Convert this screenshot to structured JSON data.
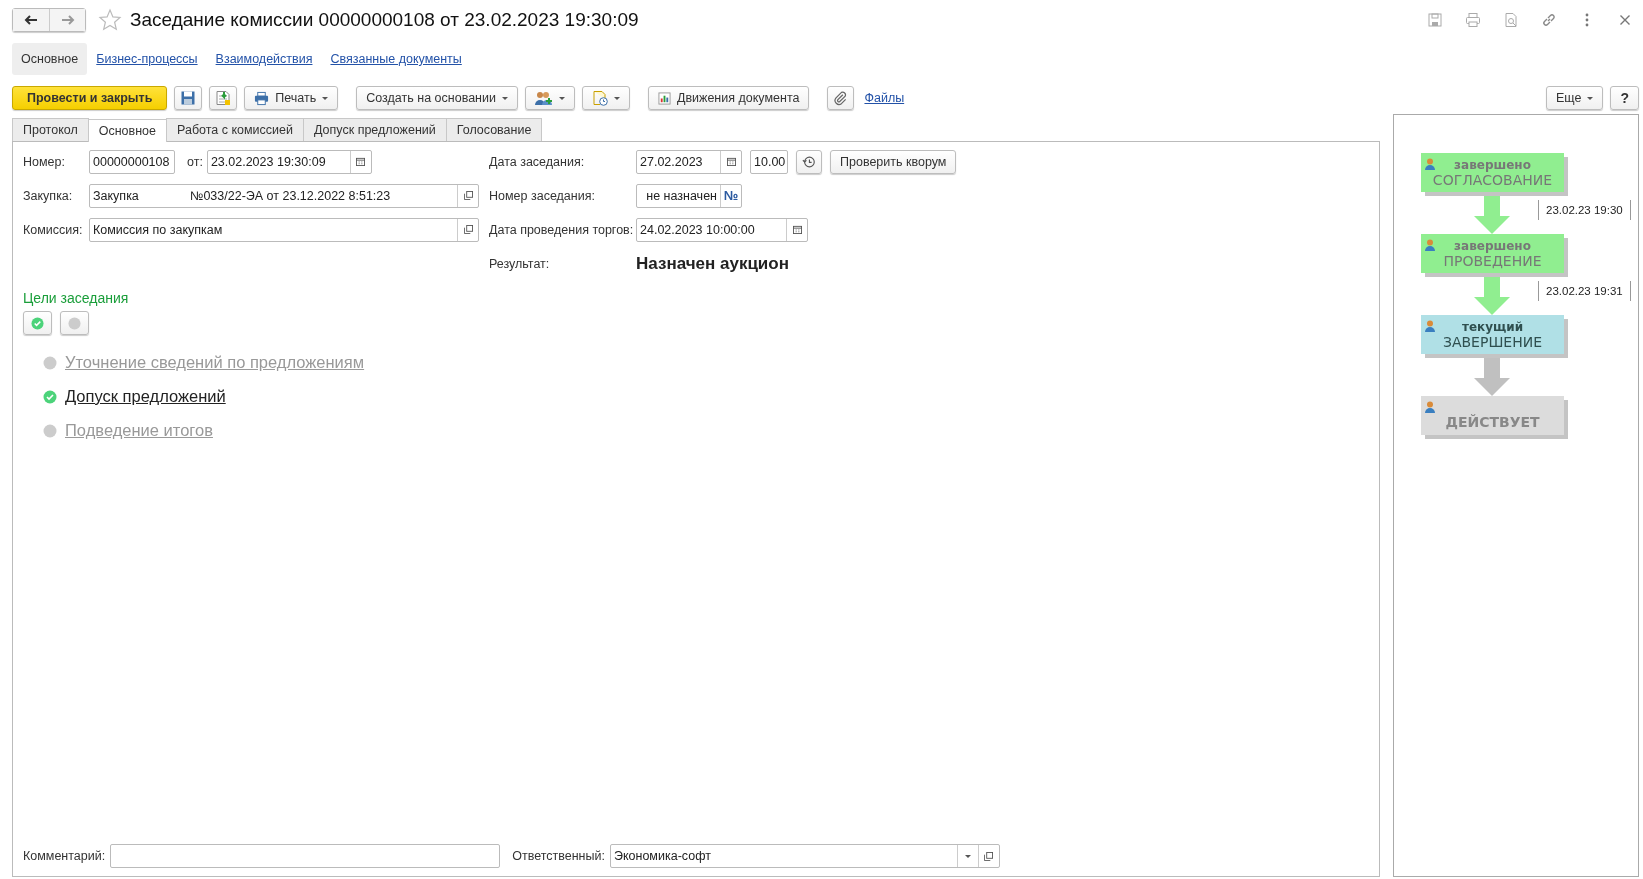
{
  "window": {
    "title": "Заседание комиссии 00000000108 от 23.02.2023 19:30:09",
    "favorite": false
  },
  "section_links": [
    {
      "label": "Основное",
      "selected": true
    },
    {
      "label": "Бизнес-процессы",
      "selected": false
    },
    {
      "label": "Взаимодействия",
      "selected": false
    },
    {
      "label": "Связанные документы",
      "selected": false
    }
  ],
  "toolbar": {
    "post_and_close": "Провести и закрыть",
    "print": "Печать",
    "create_based_on": "Создать на основании",
    "movements": "Движения документа",
    "files": "Файлы",
    "more": "Еще",
    "help": "?"
  },
  "tabs": [
    {
      "label": "Протокол",
      "selected": false
    },
    {
      "label": "Основное",
      "selected": true
    },
    {
      "label": "Работа с комиссией",
      "selected": false
    },
    {
      "label": "Допуск предложений",
      "selected": false
    },
    {
      "label": "Голосование",
      "selected": false
    }
  ],
  "form": {
    "number_label": "Номер:",
    "number": "00000000108",
    "from_label": "от:",
    "from": "23.02.2023 19:30:09",
    "purchase_label": "Закупка:",
    "purchase_type": "Закупка",
    "purchase": "№033/22-ЭА от 23.12.2022 8:51:23",
    "commission_label": "Комиссия:",
    "commission": "Комиссия по закупкам",
    "meeting_date_label": "Дата заседания:",
    "meeting_date": "27.02.2023",
    "meeting_time": "10.00",
    "check_quorum": "Проверить кворум",
    "meeting_number_label": "Номер заседания:",
    "meeting_number": "не назначен",
    "number_sign": "№",
    "trading_date_label": "Дата проведения торгов:",
    "trading_date": "24.02.2023 10:00:00",
    "result_label": "Результат:",
    "result": "Назначен аукцион"
  },
  "goals": {
    "title": "Цели заседания",
    "items": [
      {
        "label": "Уточнение сведений по предложениям",
        "done": false
      },
      {
        "label": "Допуск предложений",
        "done": true
      },
      {
        "label": "Подведение итогов",
        "done": false
      }
    ]
  },
  "footer": {
    "comment_label": "Комментарий:",
    "responsible_label": "Ответственный:",
    "responsible": "Экономика-софт"
  },
  "process": {
    "stages": [
      {
        "status": "завершено",
        "name": "СОГЛАСОВАНИЕ",
        "color": "#90ee90",
        "kind": "done"
      },
      {
        "status": "завершено",
        "name": "ПРОВЕДЕНИЕ",
        "color": "#90ee90",
        "kind": "done"
      },
      {
        "status": "текущий",
        "name": "ЗАВЕРШЕНИЕ",
        "color": "#b0e0e6",
        "kind": "current"
      },
      {
        "name": "ДЕЙСТВУЕТ",
        "color": "#dcdcdc",
        "kind": "pending"
      }
    ],
    "arrows": [
      {
        "color": "#90ee90",
        "time": "23.02.23 19:30"
      },
      {
        "color": "#90ee90",
        "time": "23.02.23 19:31"
      },
      {
        "color": "#c0c0c0"
      }
    ]
  }
}
